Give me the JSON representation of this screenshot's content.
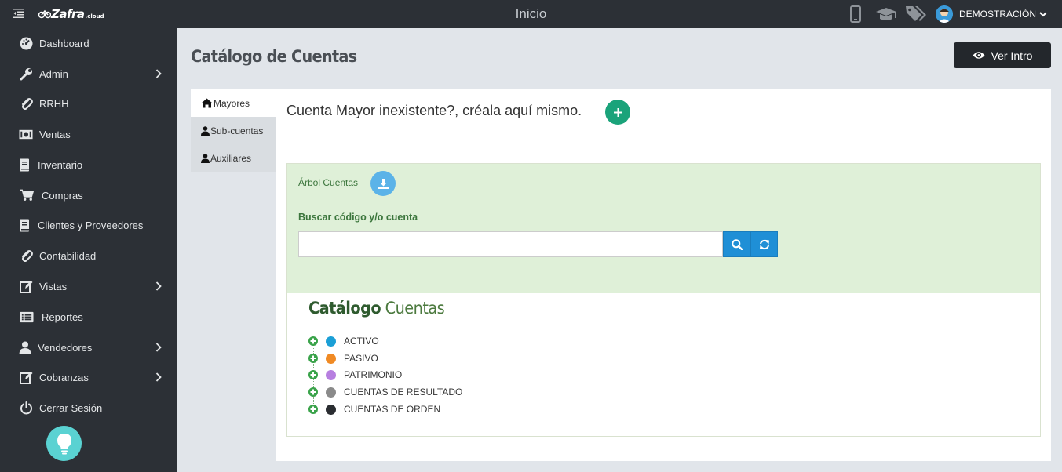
{
  "header": {
    "logo_main": "Zafra",
    "logo_sub": ".cloud",
    "title": "Inicio",
    "user_name": "DEMOSTRACIÓN",
    "icons": [
      "mobile-icon",
      "graduation-cap-icon",
      "tags-icon"
    ]
  },
  "sidebar": {
    "items": [
      {
        "label": "Dashboard",
        "icon": "dashboard-icon",
        "has_arrow": false
      },
      {
        "label": "Admin",
        "icon": "wrench-icon",
        "has_arrow": true
      },
      {
        "label": "RRHH",
        "icon": "paperclip-icon",
        "has_arrow": false
      },
      {
        "label": "Ventas",
        "icon": "money-icon",
        "has_arrow": false
      },
      {
        "label": "Inventario",
        "icon": "book-icon",
        "has_arrow": false
      },
      {
        "label": "Compras",
        "icon": "cart-icon",
        "has_arrow": false
      },
      {
        "label": "Clientes y Proveedores",
        "icon": "book-icon",
        "has_arrow": false
      },
      {
        "label": "Contabilidad",
        "icon": "paperclip-icon",
        "has_arrow": false
      },
      {
        "label": "Vistas",
        "icon": "edit-icon",
        "has_arrow": true
      },
      {
        "label": "Reportes",
        "icon": "list-icon",
        "has_arrow": false
      },
      {
        "label": "Vendedores",
        "icon": "user-icon",
        "has_arrow": true
      },
      {
        "label": "Cobranzas",
        "icon": "edit-icon",
        "has_arrow": true
      },
      {
        "label": "Cerrar Sesión",
        "icon": "power-icon",
        "has_arrow": false
      }
    ],
    "help_icon": "lightbulb-icon"
  },
  "main": {
    "title": "Catálogo de Cuentas",
    "intro_button": "Ver Intro",
    "tabs": [
      {
        "label": "Mayores",
        "icon": "home-icon",
        "active": true
      },
      {
        "label": "Sub-cuentas",
        "icon": "user-icon",
        "active": false
      },
      {
        "label": "Auxiliares",
        "icon": "user-icon",
        "active": false
      }
    ],
    "create_hint": "Cuenta Mayor inexistente?, créala aquí mismo.",
    "tree": {
      "label": "Árbol Cuentas",
      "search_label": "Buscar código y/o cuenta",
      "search_value": "",
      "search_placeholder": "",
      "catalog_title_bold": "Catálogo",
      "catalog_title_normal": "Cuentas",
      "nodes": [
        {
          "label": "ACTIVO",
          "color": "#1b9fd6"
        },
        {
          "label": "PASIVO",
          "color": "#f08a24"
        },
        {
          "label": "PATRIMONIO",
          "color": "#b77fe0"
        },
        {
          "label": "CUENTAS DE RESULTADO",
          "color": "#8a8a8a"
        },
        {
          "label": "CUENTAS DE ORDEN",
          "color": "#2a2d31"
        }
      ]
    }
  },
  "colors": {
    "sidebar_bg": "#2c3036",
    "add_green": "#1aa37a",
    "search_blue": "#1f8fd6",
    "tree_green_bg": "#dff0d8"
  }
}
